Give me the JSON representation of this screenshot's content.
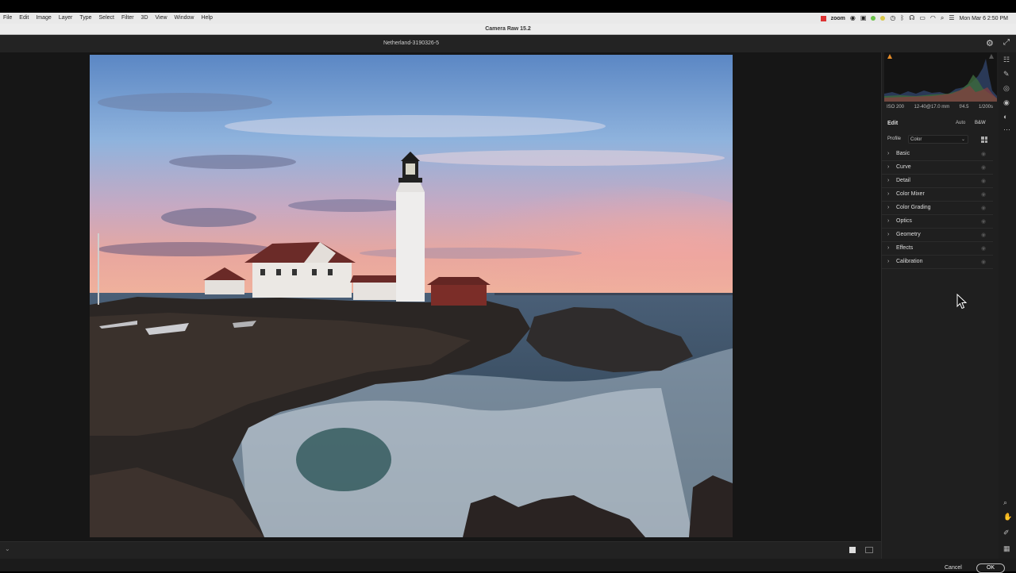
{
  "menubar": {
    "items": [
      "File",
      "Edit",
      "Image",
      "Layer",
      "Type",
      "Select",
      "Filter",
      "3D",
      "View",
      "Window",
      "Help"
    ],
    "tray_zoom": "zoom",
    "clock": "Mon Mar 6  2:50 PM"
  },
  "window": {
    "title": "Camera Raw 15.2"
  },
  "file": {
    "name": "Netherland-3190326-5"
  },
  "exif": {
    "iso": "ISO 200",
    "lens": "12-40@17.0 mm",
    "aperture": "f/4.5",
    "shutter": "1/200s"
  },
  "edit": {
    "title": "Edit",
    "auto_label": "Auto",
    "bw_label": "B&W",
    "profile_label": "Profile",
    "profile_value": "Color"
  },
  "sections": [
    "Basic",
    "Curve",
    "Detail",
    "Color Mixer",
    "Color Grading",
    "Optics",
    "Geometry",
    "Effects",
    "Calibration"
  ],
  "footer": {
    "cancel": "Cancel",
    "ok": "OK"
  },
  "colors": {
    "accent_orange": "#e38a28",
    "tray_red": "#d33333"
  },
  "icons": [
    "apple-menu",
    "gear-icon",
    "expand-icon",
    "histogram-warning-icon",
    "grid-icon",
    "eye-icon",
    "chevron-right-icon",
    "edit-sliders-icon",
    "heal-brush-icon",
    "mask-icon",
    "red-eye-icon",
    "presets-icon",
    "more-icon",
    "zoom-icon",
    "hand-icon",
    "eyedropper-icon",
    "grid-overlay-icon"
  ]
}
